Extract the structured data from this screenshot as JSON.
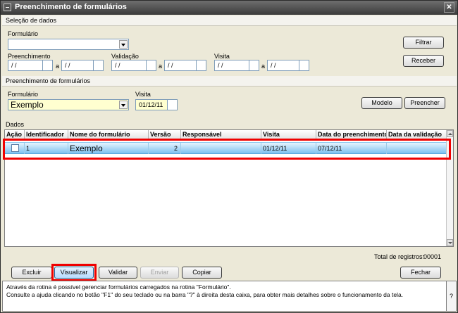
{
  "window": {
    "title": "Preenchimento de formulários",
    "close_glyph": "✕"
  },
  "selecao": {
    "header": "Seleção de dados",
    "formulario_label": "Formulário",
    "formulario_value": "",
    "preenchimento_label": "Preenchimento",
    "validacao_label": "Validação",
    "visita_label": "Visita",
    "a_label": "a",
    "date_placeholder": "/ /",
    "filtrar_label": "Filtrar",
    "receber_label": "Receber"
  },
  "preenchimento": {
    "header": "Preenchimento de formulários",
    "formulario_label": "Formulário",
    "formulario_value": "Exemplo",
    "visita_label": "Visita",
    "visita_value": "01/12/11",
    "modelo_label": "Modelo",
    "preencher_label": "Preencher"
  },
  "dados": {
    "header": "Dados",
    "columns": [
      "Ação",
      "Identificador",
      "Nome do formulário",
      "Versão",
      "Responsável",
      "Visita",
      "Data do preenchimento",
      "Data da validação"
    ],
    "rows": [
      {
        "acao": "",
        "identificador": "1",
        "nome": "Exemplo",
        "versao": "2",
        "responsavel": "",
        "visita": "01/12/11",
        "data_preenchimento": "07/12/11",
        "data_validacao": ""
      }
    ],
    "total_label": "Total de registros:",
    "total_value": "00001"
  },
  "actions": {
    "excluir": "Excluir",
    "visualizar": "Visualizar",
    "validar": "Validar",
    "enviar": "Enviar",
    "copiar": "Copiar",
    "fechar": "Fechar"
  },
  "help": {
    "line1": "Através da rotina é possível gerenciar formulários carregados na rotina \"Formulário\".",
    "line2": "Consulte a ajuda clicando no botão \"F1\" do seu teclado ou na barra \"?\" à direita desta caixa, para obter mais detalhes sobre o funcionamento da tela.",
    "help_glyph": "?"
  },
  "colors": {
    "highlight": "#ef0000",
    "selected_row": "#7cc1f0",
    "combo_yellow": "#ffffd0"
  }
}
